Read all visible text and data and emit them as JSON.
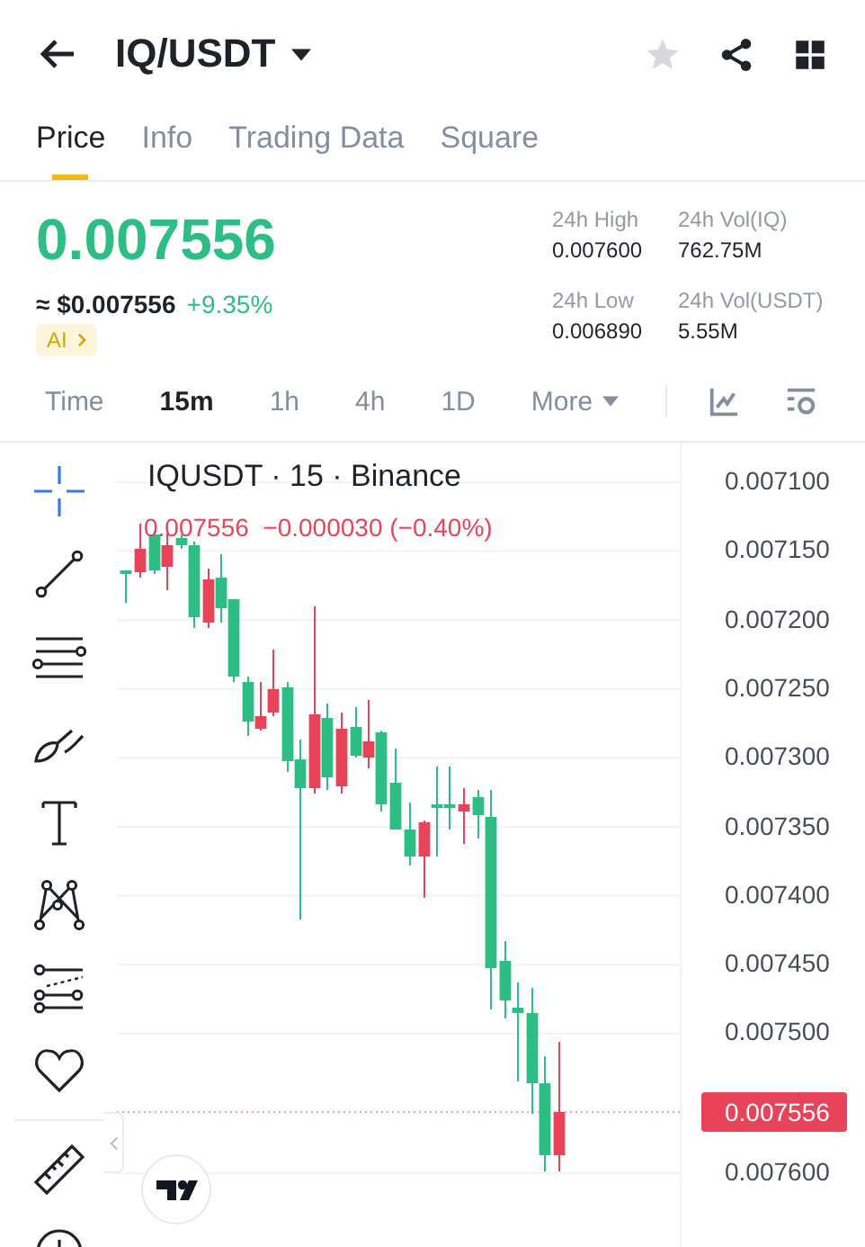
{
  "header": {
    "pair": "IQ/USDT",
    "favorite": false
  },
  "tabs": [
    {
      "label": "Price",
      "selected": true
    },
    {
      "label": "Info",
      "selected": false
    },
    {
      "label": "Trading Data",
      "selected": false
    },
    {
      "label": "Square",
      "selected": false
    }
  ],
  "price": {
    "last": "0.007556",
    "fiat": "≈ $0.007556",
    "change": "+9.35%",
    "ai_badge": "AI"
  },
  "stats": [
    {
      "label": "24h High",
      "value": "0.007600"
    },
    {
      "label": "24h Vol(IQ)",
      "value": "762.75M"
    },
    {
      "label": "24h Low",
      "value": "0.006890"
    },
    {
      "label": "24h Vol(USDT)",
      "value": "5.55M"
    }
  ],
  "timeframes": [
    {
      "label": "Time",
      "selected": false
    },
    {
      "label": "15m",
      "selected": true
    },
    {
      "label": "1h",
      "selected": false
    },
    {
      "label": "4h",
      "selected": false
    },
    {
      "label": "1D",
      "selected": false
    },
    {
      "label": "More",
      "selected": false
    }
  ],
  "tools": [
    {
      "kind": "crosshair",
      "selected": true
    },
    {
      "kind": "trend-line",
      "selected": false
    },
    {
      "kind": "parallel-lines",
      "selected": false
    },
    {
      "kind": "brush",
      "selected": false
    },
    {
      "kind": "text",
      "selected": false
    },
    {
      "kind": "pattern",
      "selected": false
    },
    {
      "kind": "fibonacci",
      "selected": false
    },
    {
      "kind": "favorites",
      "selected": false
    },
    {
      "kind": "ruler",
      "selected": false
    },
    {
      "kind": "circle",
      "selected": false
    }
  ],
  "chart": {
    "title": "IQUSDT · 15 · Binance",
    "ohlc": "0.007556  −0.000030 (−0.40%)",
    "price_ticks": [
      "0.007100",
      "0.007150",
      "0.007200",
      "0.007250",
      "0.007300",
      "0.007350",
      "0.007400",
      "0.007450",
      "0.007500",
      "0.007600"
    ],
    "last_price": "0.007556"
  }
}
